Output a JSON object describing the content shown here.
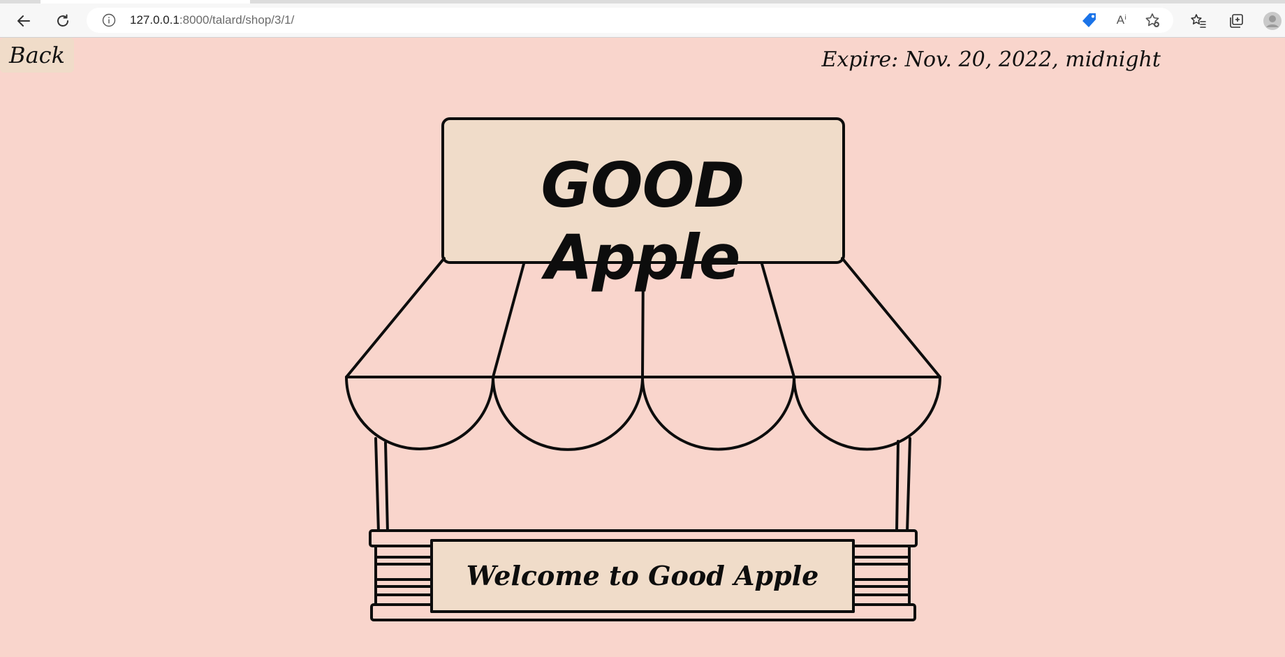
{
  "browser": {
    "url_host": "127.0.0.1",
    "url_path": ":8000/talard/shop/3/1/",
    "icons": {
      "back": "back-arrow-icon",
      "reload": "reload-icon",
      "info": "info-icon",
      "coupon": "tag-icon",
      "read_aloud": "read-aloud-icon",
      "add_favorite": "add-favorite-icon",
      "favorites": "favorites-icon",
      "collections": "collections-icon",
      "profile": "profile-avatar-icon"
    },
    "read_aloud_label": "Aⁱ"
  },
  "page": {
    "back_label": "Back",
    "expire_text": "Expire: Nov. 20, 2022, midnight",
    "shop_name": "GOOD Apple",
    "welcome_text": "Welcome to Good Apple"
  },
  "colors": {
    "page_background": "#f9d5cc",
    "sign_fill": "#f0dcc9",
    "back_button_fill": "#f0dcc9",
    "outline": "#0d0d0d"
  }
}
